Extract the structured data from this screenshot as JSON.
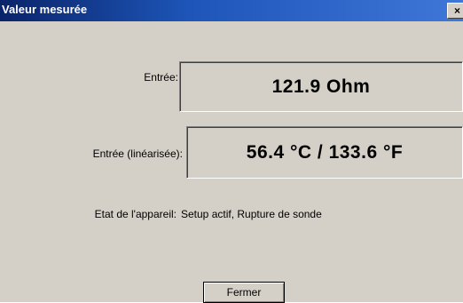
{
  "window": {
    "title": "Valeur mesurée",
    "close_glyph": "×"
  },
  "fields": {
    "input_label": "Entrée:",
    "input_value": "121.9 Ohm",
    "linearized_label": "Entrée (linéarisée):",
    "linearized_value": "56.4 °C / 133.6 °F",
    "state_label": "Etat de l'appareil:",
    "state_value": "Setup actif, Rupture de sonde"
  },
  "buttons": {
    "close_label": "Fermer"
  },
  "colors": {
    "titlebar": "#0a246a",
    "window_bg": "#d4d0c8"
  }
}
